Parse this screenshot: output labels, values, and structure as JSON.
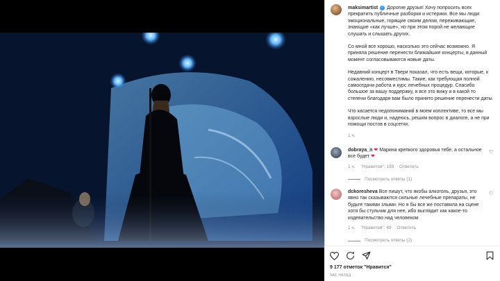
{
  "post": {
    "username": "maksimartist",
    "caption_first": "Дорогие друзья! Хочу попросить всех прекратить публичные разборки и истерики. Все мы люди эмоциональные, горящие своим делом, переживающие, знающие «как лучше», но при этом порой не желающие слушать и слышать других.",
    "caption_paragraphs": [
      "Со мной все хорошо, насколько это сейчас возможно. Я приняла решение перенести ближайшие концерты, в данный момент согласовываются новые даты.",
      "Недавний концерт в Твери показал, что есть вещи, которые, к сожалению, несовместимы. Такие, как требующая полной самоотдачи работа и курс лечебных процедур. Спасибо большое за вашу поддержку, я все это вижу и в какой то степени благодаря вам было принято решение перенести даты.",
      "Что касается недопониманий в моем коллективе, то все мы взрослые люди и, надеюсь, решим вопрос в диалоге, а не при помощи постов в соцсетях."
    ],
    "time": "1 ч."
  },
  "comments": [
    {
      "username": "dobraya_n",
      "text": "Марина крепкого здоровья тебе, а остальное все будет",
      "time": "1 ч.",
      "likes": "\"Нравится\": 139",
      "reply": "Ответить",
      "view_replies": "Посмотреть ответы (1)"
    },
    {
      "username": "dckoresheva",
      "text": "Все пишут, что якобы алкоголь, друзья, это явно так сказываются сильные лечебные препараты, не будьте такими злыми. Но я бы все же поставила на сцене хотя бы стульчик для нее, ибо выглядит как какое-то издевательство над человеком",
      "time": "1 ч.",
      "likes": "\"Нравится\": 49",
      "reply": "Ответить",
      "view_replies": "Посмотреть ответы (2)"
    }
  ],
  "footer": {
    "likes_text": "9 177 отметок \"Нравится\"",
    "ago": "ЧАС НАЗАД"
  },
  "icons": {
    "like": "heart-icon",
    "comment": "comment-icon",
    "share": "share-icon",
    "save": "bookmark-icon",
    "verified": "verified-badge-icon",
    "comment_like": "heart-icon"
  },
  "colors": {
    "verified": "#3897f0",
    "heart_emoji": "#e0245e",
    "muted": "#8e8e8e",
    "text": "#262626"
  }
}
